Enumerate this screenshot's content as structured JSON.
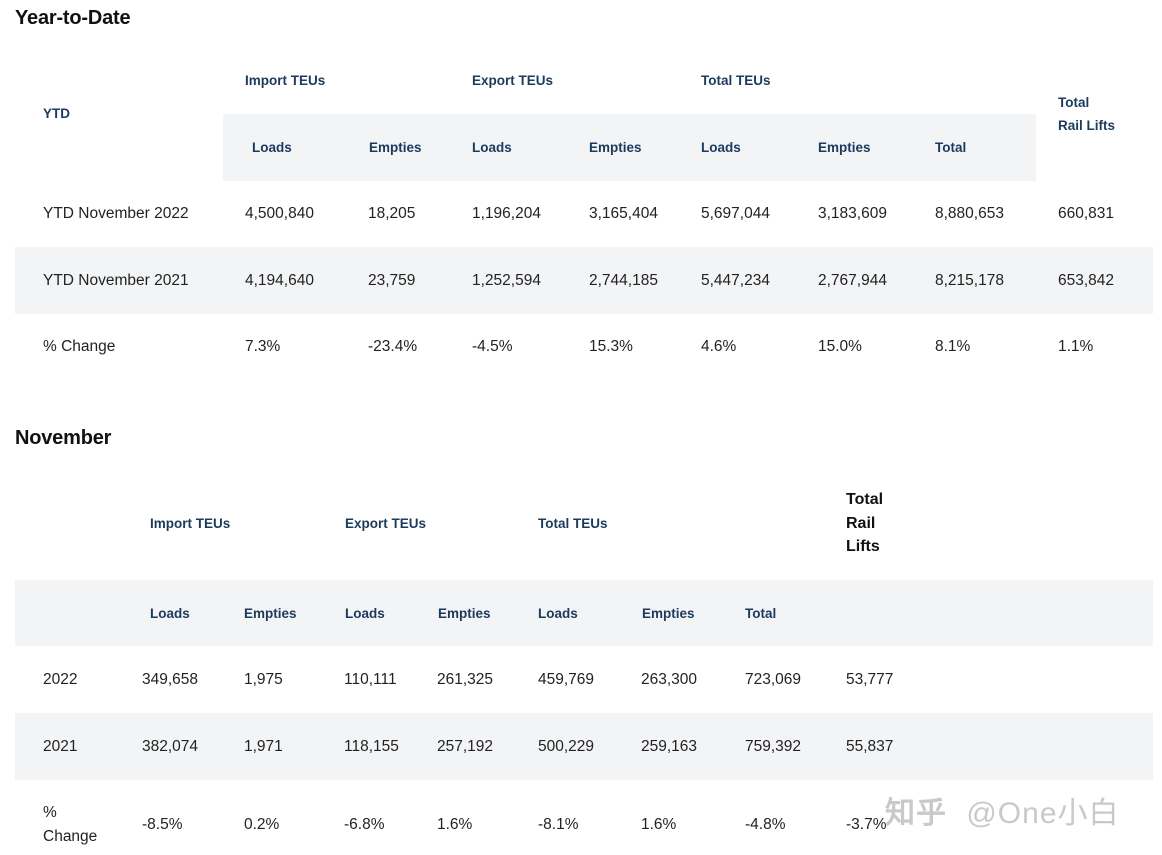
{
  "ytd": {
    "title": "Year-to-Date",
    "row_label_header": "YTD",
    "groups": [
      "Import TEUs",
      "Export TEUs",
      "Total TEUs"
    ],
    "rail_header": [
      "Total",
      "Rail Lifts"
    ],
    "subheaders": [
      "Loads",
      "Empties",
      "Loads",
      "Empties",
      "Loads",
      "Empties",
      "Total"
    ],
    "rows": [
      {
        "label": "YTD November 2022",
        "values": [
          "4,500,840",
          "18,205",
          "1,196,204",
          "3,165,404",
          "5,697,044",
          "3,183,609",
          "8,880,653",
          "660,831"
        ]
      },
      {
        "label": "YTD November 2021",
        "values": [
          "4,194,640",
          "23,759",
          "1,252,594",
          "2,744,185",
          "5,447,234",
          "2,767,944",
          "8,215,178",
          "653,842"
        ]
      },
      {
        "label": "% Change",
        "values": [
          "7.3%",
          "-23.4%",
          "-4.5%",
          "15.3%",
          "4.6%",
          "15.0%",
          "8.1%",
          "1.1%"
        ]
      }
    ]
  },
  "november": {
    "title": "November",
    "groups": [
      "Import TEUs",
      "Export TEUs",
      "Total TEUs"
    ],
    "rail_header": [
      "Total",
      "Rail",
      "Lifts"
    ],
    "subheaders": [
      "Loads",
      "Empties",
      "Loads",
      "Empties",
      "Loads",
      "Empties",
      "Total"
    ],
    "rows": [
      {
        "label": [
          "2022"
        ],
        "values": [
          "349,658",
          "1,975",
          "110,111",
          "261,325",
          "459,769",
          "263,300",
          "723,069",
          "53,777"
        ]
      },
      {
        "label": [
          "2021"
        ],
        "values": [
          "382,074",
          "1,971",
          "118,155",
          "257,192",
          "500,229",
          "259,163",
          "759,392",
          "55,837"
        ]
      },
      {
        "label": [
          "%",
          "Change"
        ],
        "values": [
          "-8.5%",
          "0.2%",
          "-6.8%",
          "1.6%",
          "-8.1%",
          "1.6%",
          "-4.8%",
          "-3.7%"
        ]
      }
    ]
  },
  "watermark": {
    "logo": "知乎",
    "handle": "@One小白"
  },
  "colors": {
    "header_text": "#1b3a5c",
    "band": "#f3f4f6"
  }
}
